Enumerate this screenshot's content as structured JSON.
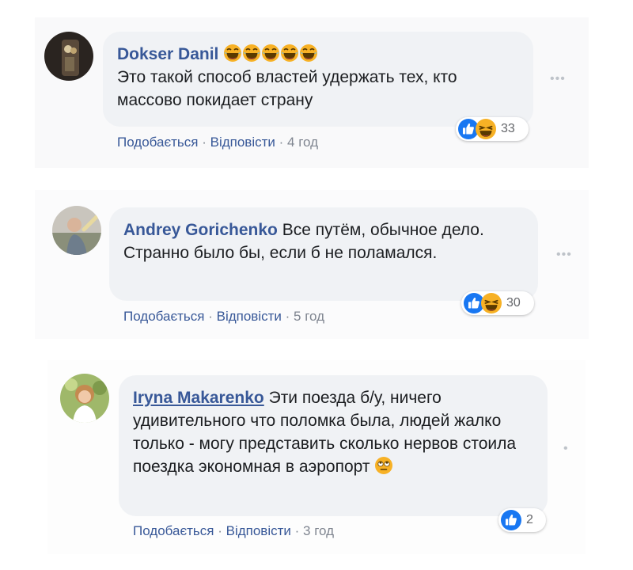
{
  "comments": [
    {
      "author": "Dokser Danil",
      "text": "Это такой способ властей удержать тех, кто массово покидает страну",
      "emoji": [
        "laughing-emoji",
        "laughing-emoji",
        "laughing-emoji",
        "laughing-emoji",
        "laughing-emoji"
      ],
      "like_label": "Подобається",
      "reply_label": "Відповісти",
      "time": "4 год",
      "reaction_count": "33",
      "reaction_icons": [
        "like-icon",
        "haha-icon"
      ]
    },
    {
      "author": "Andrey Gorichenko",
      "text": "Все путём, обычное дело. Странно было бы, если б не поламался.",
      "like_label": "Подобається",
      "reply_label": "Відповісти",
      "time": "5 год",
      "reaction_count": "30",
      "reaction_icons": [
        "like-icon",
        "haha-icon"
      ]
    },
    {
      "author": "Iryna Makarenko",
      "text": "Эти поезда б/у, ничего удивительного что поломка была, людей жалко только - могу представить сколько нервов стоила поездка экономная в аэропорт",
      "trailing_emoji": "rolling-eyes-emoji",
      "like_label": "Подобається",
      "reply_label": "Відповісти",
      "time": "3 год",
      "reaction_count": "2",
      "reaction_icons": [
        "like-icon"
      ]
    }
  ],
  "colors": {
    "link": "#385898",
    "bubble": "#f0f2f5",
    "text": "#1c1e21",
    "meta": "#7f8590",
    "like_blue": "#1877f2",
    "haha_yellow": "#f7b125"
  }
}
